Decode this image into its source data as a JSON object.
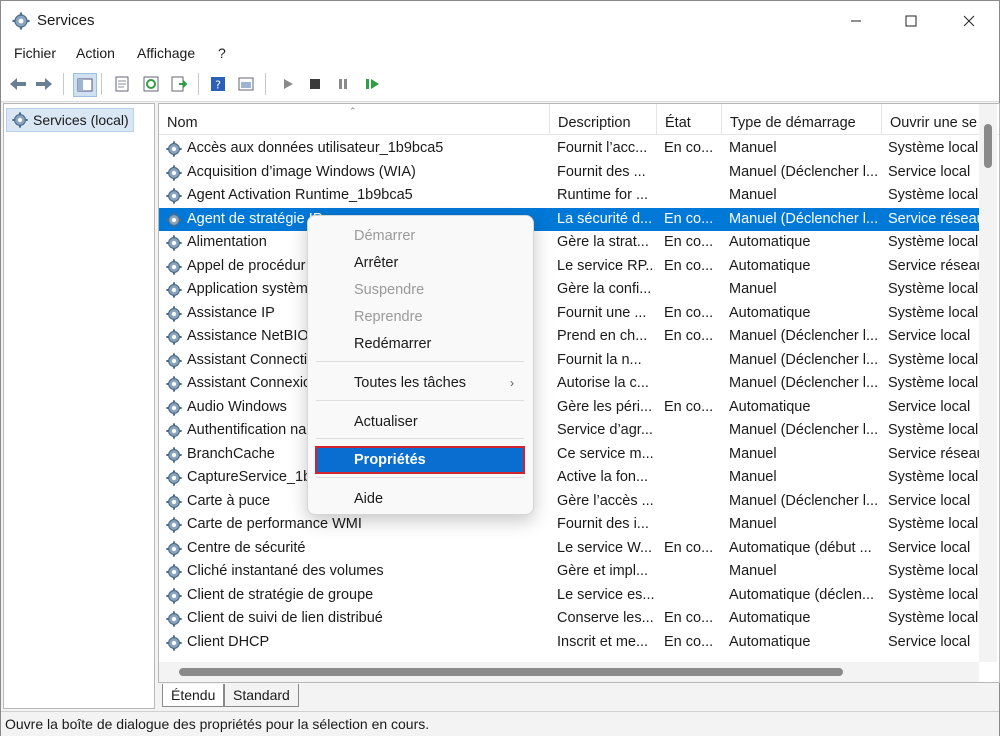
{
  "window": {
    "title": "Services"
  },
  "menu": [
    "Fichier",
    "Action",
    "Affichage",
    "?"
  ],
  "tree": {
    "root_label": "Services (local)"
  },
  "columns": [
    "Nom",
    "Description",
    "État",
    "Type de démarrage",
    "Ouvrir une se"
  ],
  "rows": [
    [
      "Accès aux données utilisateur_1b9bca5",
      "Fournit l’acc...",
      "En co...",
      "Manuel",
      "Système local"
    ],
    [
      "Acquisition d’image Windows (WIA)",
      "Fournit des ...",
      "",
      "Manuel (Déclencher l...",
      "Service local"
    ],
    [
      "Agent Activation Runtime_1b9bca5",
      "Runtime for ...",
      "",
      "Manuel",
      "Système local"
    ],
    [
      "Agent de stratégie IP",
      "La sécurité d...",
      "En co...",
      "Manuel (Déclencher l...",
      "Service réseau"
    ],
    [
      "Alimentation",
      "Gère la strat...",
      "En co...",
      "Automatique",
      "Système local"
    ],
    [
      "Appel de procédur",
      "Le service RP...",
      "En co...",
      "Automatique",
      "Service réseau"
    ],
    [
      "Application systèm",
      "Gère la confi...",
      "",
      "Manuel",
      "Système local"
    ],
    [
      "Assistance IP",
      "Fournit une ...",
      "En co...",
      "Automatique",
      "Système local"
    ],
    [
      "Assistance NetBIOS",
      "Prend en ch...",
      "En co...",
      "Manuel (Déclencher l...",
      "Service local"
    ],
    [
      "Assistant Connecti",
      "Fournit la n...",
      "",
      "Manuel (Déclencher l...",
      "Système local"
    ],
    [
      "Assistant Connexic",
      "Autorise la c...",
      "",
      "Manuel (Déclencher l...",
      "Système local"
    ],
    [
      "Audio Windows",
      "Gère les péri...",
      "En co...",
      "Automatique",
      "Service local"
    ],
    [
      "Authentification na",
      "Service d’agr...",
      "",
      "Manuel (Déclencher l...",
      "Système local"
    ],
    [
      "BranchCache",
      "Ce service m...",
      "",
      "Manuel",
      "Service réseau"
    ],
    [
      "CaptureService_1b",
      "Active la fon...",
      "",
      "Manuel",
      "Système local"
    ],
    [
      "Carte à puce",
      "Gère l’accès ...",
      "",
      "Manuel (Déclencher l...",
      "Service local"
    ],
    [
      "Carte de performance WMI",
      "Fournit des i...",
      "",
      "Manuel",
      "Système local"
    ],
    [
      "Centre de sécurité",
      "Le service W...",
      "En co...",
      "Automatique (début ...",
      "Service local"
    ],
    [
      "Cliché instantané des volumes",
      "Gère et impl...",
      "",
      "Manuel",
      "Système local"
    ],
    [
      "Client de stratégie de groupe",
      "Le service es...",
      "",
      "Automatique (déclen...",
      "Système local"
    ],
    [
      "Client de suivi de lien distribué",
      "Conserve les...",
      "En co...",
      "Automatique",
      "Système local"
    ],
    [
      "Client DHCP",
      "Inscrit et me...",
      "En co...",
      "Automatique",
      "Service local"
    ]
  ],
  "selected_row_index": 3,
  "context_menu": {
    "items": [
      "Démarrer",
      "Arrêter",
      "Suspendre",
      "Reprendre",
      "Redémarrer",
      "Toutes les tâches",
      "Actualiser",
      "Propriétés",
      "Aide"
    ],
    "disabled": [
      "Démarrer",
      "Suspendre",
      "Reprendre"
    ],
    "highlighted": "Propriétés",
    "submenu_arrow": "›"
  },
  "tabs": [
    "Étendu",
    "Standard"
  ],
  "status": "Ouvre la boîte de dialogue des propriétés pour la sélection en cours.",
  "colors": {
    "selection": "#0078d7",
    "highlight_border": "#d1242f"
  },
  "icons": [
    "gear-icon",
    "back-icon",
    "forward-icon",
    "play-icon",
    "stop-icon",
    "pause-icon",
    "restart-icon"
  ]
}
